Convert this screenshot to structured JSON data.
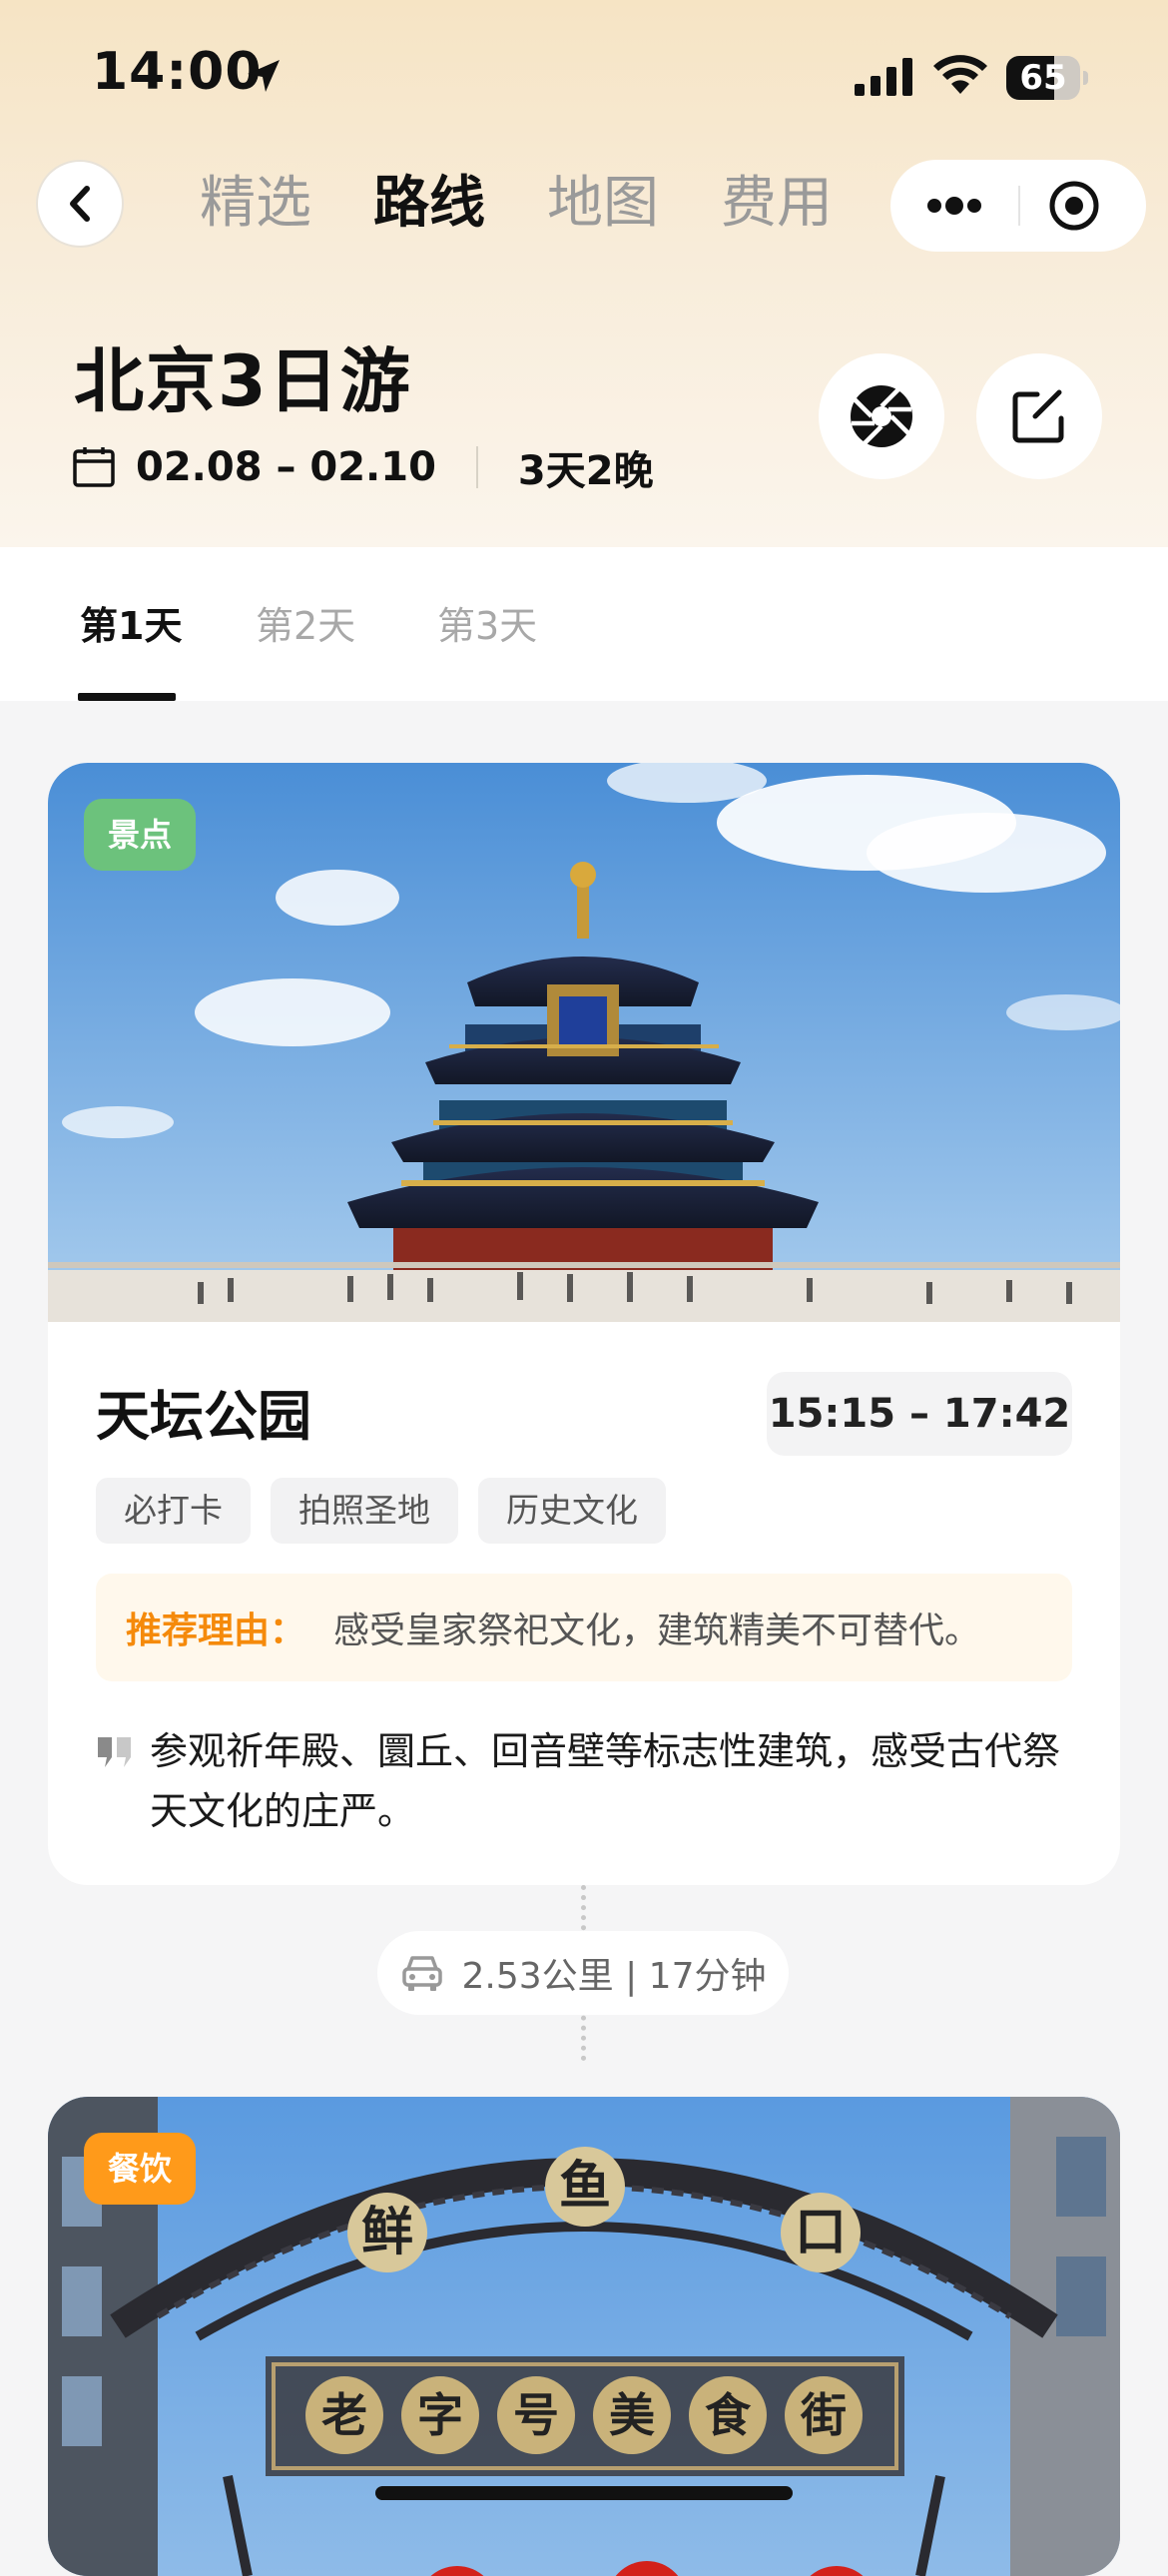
{
  "status_bar": {
    "time": "14:00",
    "battery": 65
  },
  "nav": {
    "tabs": [
      {
        "label": "精选",
        "active": false
      },
      {
        "label": "路线",
        "active": true
      },
      {
        "label": "地图",
        "active": false
      },
      {
        "label": "费用",
        "active": false
      }
    ]
  },
  "trip": {
    "title": "北京3日游",
    "dates": "02.08 – 02.10",
    "duration": "3天2晚"
  },
  "day_tabs": [
    "第1天",
    "第2天",
    "第3天"
  ],
  "spots": [
    {
      "tag": "景点",
      "tag_color": "#6cc27c",
      "name": "天坛公园",
      "time": "15:15 – 17:42",
      "chips": [
        "必打卡",
        "拍照圣地",
        "历史文化"
      ],
      "reason_label": "推荐理由：",
      "reason": "感受皇家祭祀文化，建筑精美不可替代。",
      "description": "参观祈年殿、圜丘、回音壁等标志性建筑，感受古代祭天文化的庄严。"
    },
    {
      "tag": "餐饮",
      "tag_color": "#ff9a1a",
      "sign_top": [
        "鲜",
        "鱼",
        "口"
      ],
      "sign_bottom": [
        "老",
        "字",
        "号",
        "美",
        "食",
        "街"
      ]
    }
  ],
  "travel": {
    "text": "2.53公里 | 17分钟"
  },
  "icons": [
    "location-arrow-icon",
    "signal-icon",
    "wifi-icon",
    "battery-icon",
    "back-chevron-icon",
    "more-dots-icon",
    "target-icon",
    "calendar-icon",
    "aperture-icon",
    "edit-icon",
    "quote-icon",
    "car-icon"
  ]
}
